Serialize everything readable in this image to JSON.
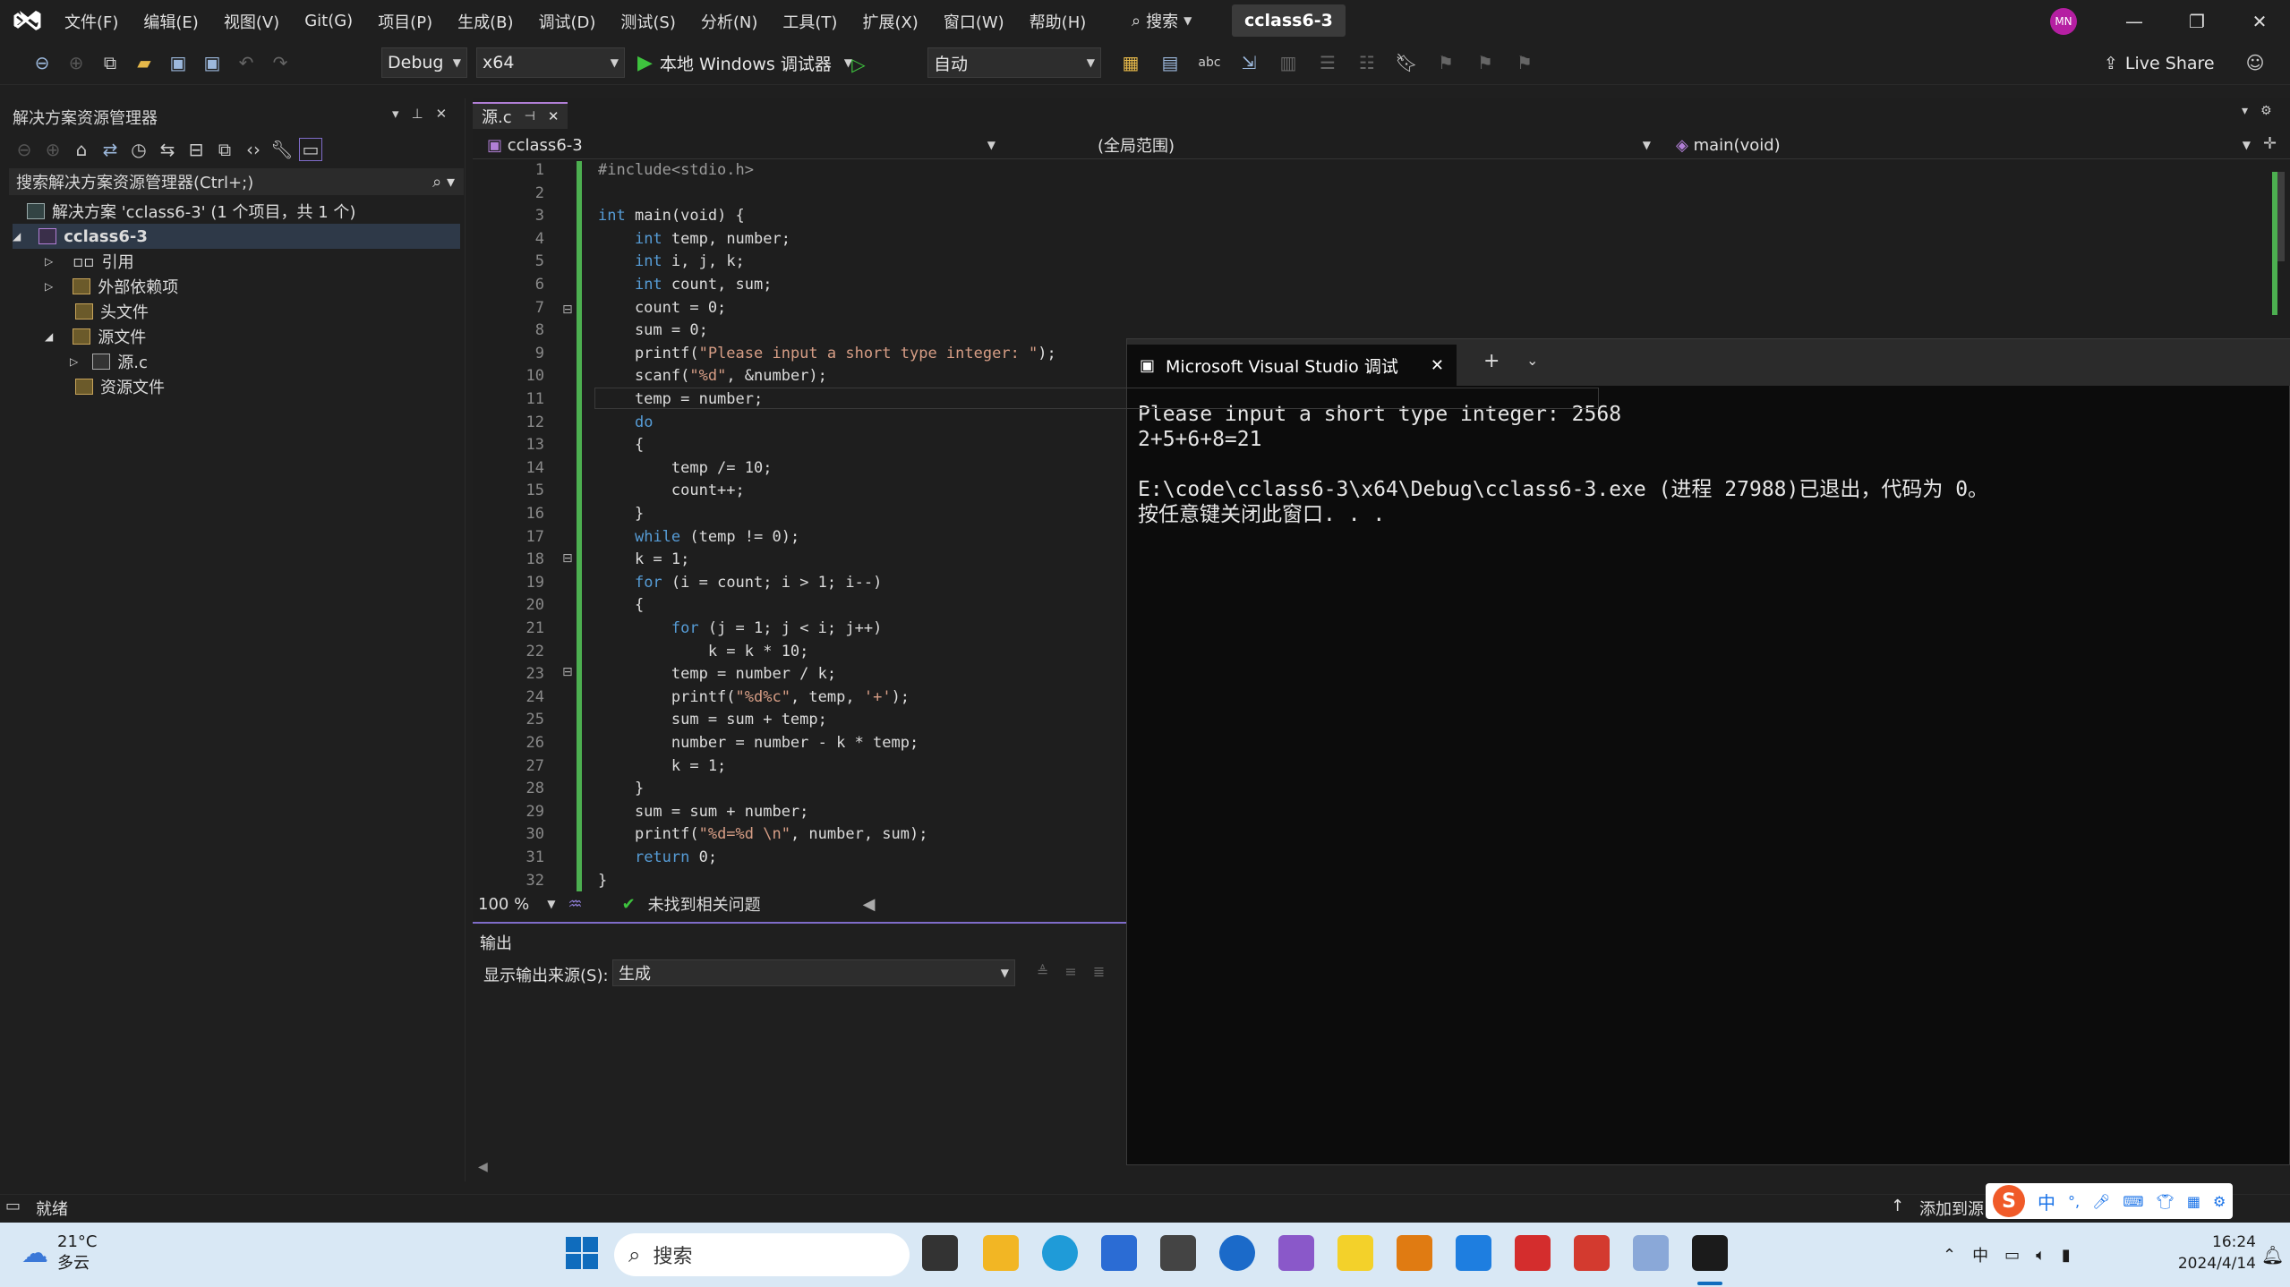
{
  "menubar": {
    "items": [
      "文件(F)",
      "编辑(E)",
      "视图(V)",
      "Git(G)",
      "项目(P)",
      "生成(B)",
      "调试(D)",
      "测试(S)",
      "分析(N)",
      "工具(T)",
      "扩展(X)",
      "窗口(W)",
      "帮助(H)"
    ],
    "search_label": "搜索",
    "project_name": "cclass6-3",
    "avatar_initials": "MN"
  },
  "toolbar": {
    "config": "Debug",
    "platform": "x64",
    "run_label": "本地 Windows 调试器",
    "auto_label": "自动",
    "live_share": "Live Share"
  },
  "solution_explorer": {
    "title": "解决方案资源管理器",
    "search_placeholder": "搜索解决方案资源管理器(Ctrl+;)",
    "solution_label": "解决方案 'cclass6-3' (1 个项目，共 1 个)",
    "project": "cclass6-3",
    "items": [
      "引用",
      "外部依赖项",
      "头文件",
      "源文件",
      "源.c",
      "资源文件"
    ]
  },
  "editor": {
    "tab_name": "源.c",
    "nav_project": "cclass6-3",
    "nav_scope": "(全局范围)",
    "nav_function": "main(void)",
    "zoom": "100 %",
    "issues": "未找到相关问题",
    "code_lines": [
      "#include<stdio.h>",
      "",
      "int main(void) {",
      "    int temp, number;",
      "    int i, j, k;",
      "    int count, sum;",
      "    count = 0;",
      "    sum = 0;",
      "    printf(\"Please input a short type integer: \");",
      "    scanf(\"%d\", &number);",
      "    temp = number;",
      "    do",
      "    {",
      "        temp /= 10;",
      "        count++;",
      "    }",
      "    while (temp != 0);",
      "    k = 1;",
      "    for (i = count; i > 1; i--)",
      "    {",
      "        for (j = 1; j < i; j++)",
      "            k = k * 10;",
      "        temp = number / k;",
      "        printf(\"%d%c\", temp, '+');",
      "        sum = sum + temp;",
      "        number = number - k * temp;",
      "        k = 1;",
      "    }",
      "    sum = sum + number;",
      "    printf(\"%d=%d \\n\", number, sum);",
      "    return 0;",
      "}"
    ],
    "current_line": 11
  },
  "output": {
    "title": "输出",
    "source_label": "显示输出来源(S):",
    "source_value": "生成"
  },
  "terminal": {
    "tab_title": "Microsoft Visual Studio 调试",
    "lines": [
      "Please input a short type integer: 2568",
      "2+5+6+8=21",
      "",
      "E:\\code\\cclass6-3\\x64\\Debug\\cclass6-3.exe (进程 27988)已退出，代码为 0。",
      "按任意键关闭此窗口. . ."
    ]
  },
  "statusbar": {
    "ready": "就绪",
    "add_source": "添加到源"
  },
  "taskbar": {
    "temperature": "21°C",
    "weather": "多云",
    "search": "搜索",
    "time": "16:24",
    "date": "2024/4/14",
    "ime": "中"
  },
  "colors": {
    "accent": "#7f6cc9",
    "green_margin": "#4caf50",
    "keyword": "#569cd6",
    "string": "#d69d85"
  }
}
